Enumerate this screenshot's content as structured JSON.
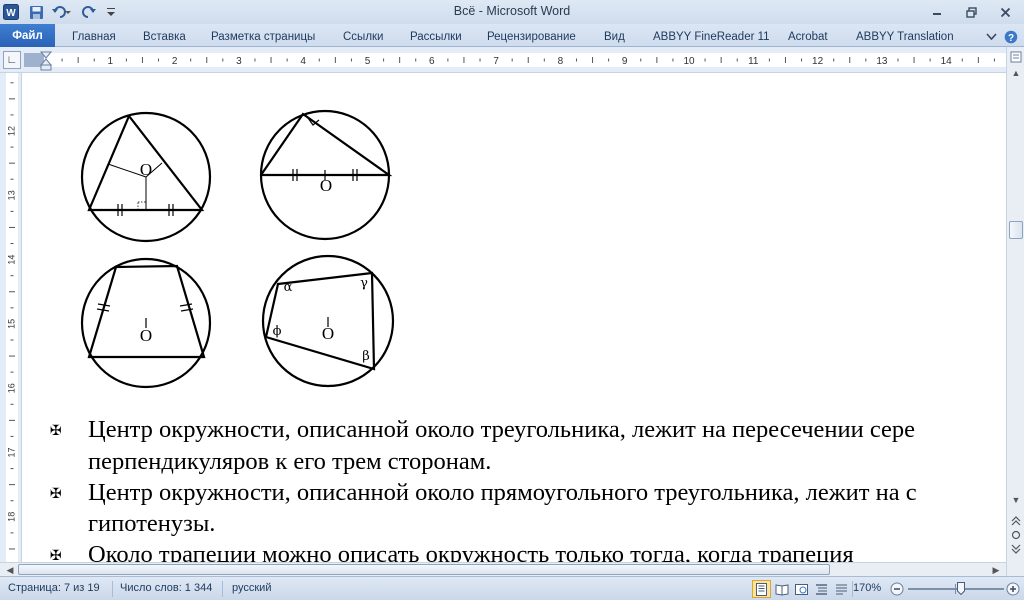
{
  "window": {
    "title": "Всё  -  Microsoft Word"
  },
  "ribbon": {
    "tabs": [
      {
        "label": "Файл"
      },
      {
        "label": "Главная"
      },
      {
        "label": "Вставка"
      },
      {
        "label": "Разметка страницы"
      },
      {
        "label": "Ссылки"
      },
      {
        "label": "Рассылки"
      },
      {
        "label": "Рецензирование"
      },
      {
        "label": "Вид"
      },
      {
        "label": "ABBYY FineReader 11"
      },
      {
        "label": "Acrobat"
      },
      {
        "label": "ABBYY Translation"
      }
    ]
  },
  "ruler": {
    "h_ticks": [
      "1",
      "2",
      "3",
      "4",
      "5",
      "6",
      "7",
      "8",
      "9",
      "10",
      "11",
      "12",
      "13",
      "14"
    ],
    "v_ticks": [
      "12",
      "13",
      "14",
      "15",
      "16",
      "17",
      "18"
    ]
  },
  "figures": {
    "center_label": "O",
    "angle_labels": {
      "alpha": "α",
      "gamma": "γ",
      "phi": "ϕ",
      "beta": "β"
    }
  },
  "document": {
    "paragraphs": [
      {
        "line1": "Центр окружности, описанной около треугольника, лежит на пересечении сере",
        "line2": "перпендикуляров к его трем сторонам."
      },
      {
        "line1": "Центр окружности, описанной около прямоугольного треугольника, лежит на с",
        "line2": "гипотенузы."
      },
      {
        "line1": "Около трапеции можно описать окружность только тогда, когда трапеция"
      }
    ]
  },
  "status": {
    "page": "Страница: 7 из 19",
    "words": "Число слов: 1 344",
    "language": "русский",
    "zoom": "170%"
  },
  "colors": {
    "file_tab": "#2a62b6",
    "chrome": "#dbe6f4"
  }
}
